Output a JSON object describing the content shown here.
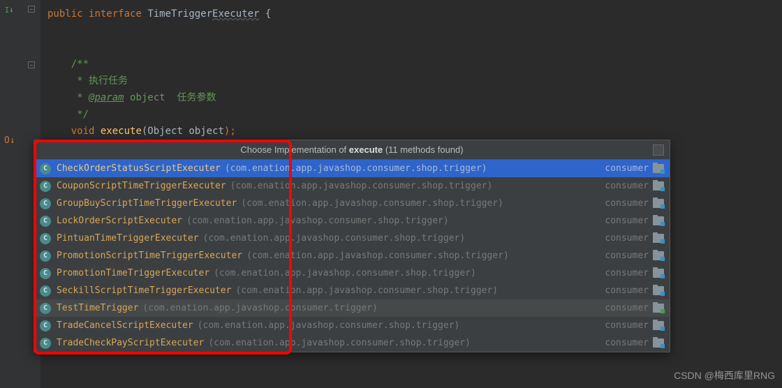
{
  "code": {
    "public": "public",
    "interface": "interface",
    "className": "TimeTrigger",
    "classNameUnderlined": "Executer",
    "openBrace": " {",
    "commentOpen": "/**",
    "commentLine1": " * 执行任务",
    "javadocTag": "@param",
    "javadocParam": " object",
    "javadocDesc": "  任务参数",
    "commentClose": " */",
    "void": "void",
    "methodName": " execute",
    "paramType": "(Object ",
    "paramName": "object",
    "paramEnd": ");"
  },
  "popup": {
    "titlePrefix": "Choose Implementation of ",
    "titleMethod": "execute",
    "titleSuffix": " (11 methods found)",
    "items": [
      {
        "name": "CheckOrderStatusScriptExecuter",
        "package": "(com.enation.app.javashop.consumer.shop.trigger)",
        "module": "consumer",
        "selected": true,
        "test": false
      },
      {
        "name": "CouponScriptTimeTriggerExecuter",
        "package": "(com.enation.app.javashop.consumer.shop.trigger)",
        "module": "consumer",
        "test": false
      },
      {
        "name": "GroupBuyScriptTimeTriggerExecuter",
        "package": "(com.enation.app.javashop.consumer.shop.trigger)",
        "module": "consumer",
        "test": false
      },
      {
        "name": "LockOrderScriptExecuter",
        "package": "(com.enation.app.javashop.consumer.shop.trigger)",
        "module": "consumer",
        "test": false
      },
      {
        "name": "PintuanTimeTriggerExecuter",
        "package": "(com.enation.app.javashop.consumer.shop.trigger)",
        "module": "consumer",
        "test": false
      },
      {
        "name": "PromotionScriptTimeTriggerExecuter",
        "package": "(com.enation.app.javashop.consumer.shop.trigger)",
        "module": "consumer",
        "test": false
      },
      {
        "name": "PromotionTimeTriggerExecuter",
        "package": "(com.enation.app.javashop.consumer.shop.trigger)",
        "module": "consumer",
        "test": false
      },
      {
        "name": "SeckillScriptTimeTriggerExecuter",
        "package": "(com.enation.app.javashop.consumer.shop.trigger)",
        "module": "consumer",
        "test": false
      },
      {
        "name": "TestTimeTrigger",
        "package": "(com.enation.app.javashop.consumer.trigger)",
        "module": "consumer",
        "highlighted": true,
        "test": true
      },
      {
        "name": "TradeCancelScriptExecuter",
        "package": "(com.enation.app.javashop.consumer.shop.trigger)",
        "module": "consumer",
        "test": false
      },
      {
        "name": "TradeCheckPayScriptExecuter",
        "package": "(com.enation.app.javashop.consumer.shop.trigger)",
        "module": "consumer",
        "test": false
      }
    ]
  },
  "classIconLetter": "C",
  "watermark": "CSDN @梅西库里RNG"
}
